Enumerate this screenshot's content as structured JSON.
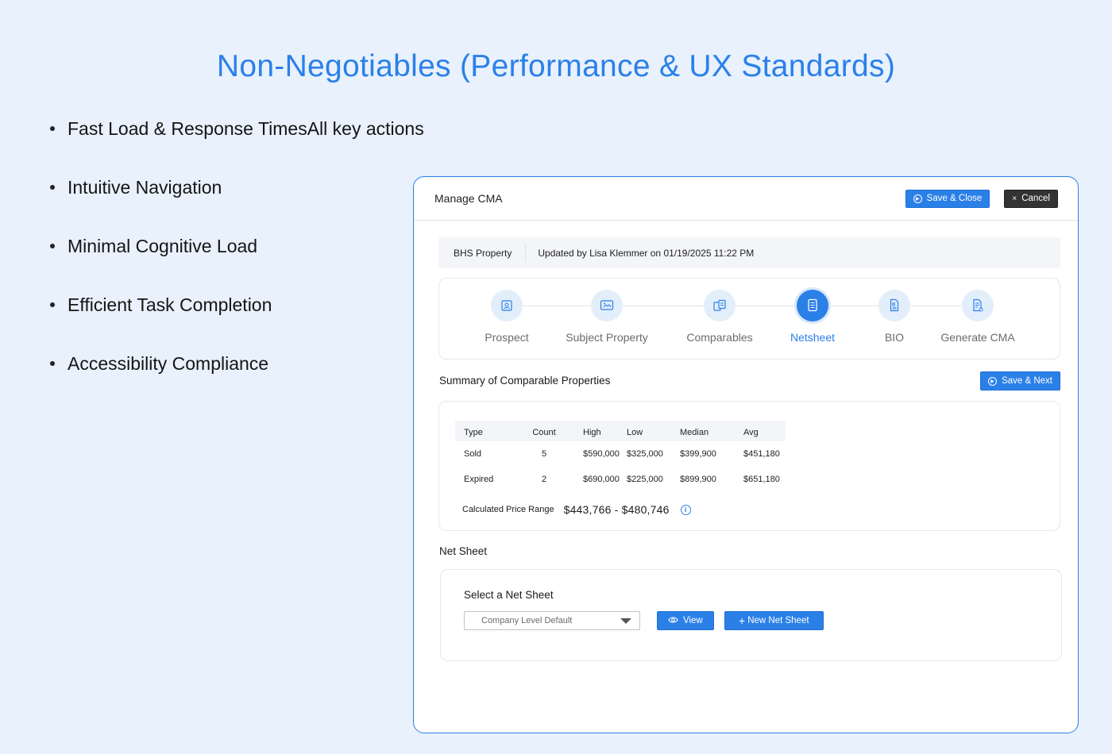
{
  "slide": {
    "title": "Non-Negotiables (Performance & UX Standards)",
    "bullets": [
      "Fast Load & Response TimesAll key actions",
      "Intuitive Navigation",
      "Minimal Cognitive Load",
      "Efficient Task Completion",
      "Accessibility Compliance"
    ]
  },
  "window": {
    "title": "Manage CMA",
    "save_close_label": "Save & Close",
    "cancel_label": "Cancel",
    "cancel_icon": "×"
  },
  "info_bar": {
    "property": "BHS Property",
    "updated": "Updated by Lisa Klemmer on 01/19/2025 11:22 PM"
  },
  "steps": [
    {
      "label": "Prospect",
      "icon": "id-card-icon",
      "active": false
    },
    {
      "label": "Subject Property",
      "icon": "property-image-icon",
      "active": false
    },
    {
      "label": "Comparables",
      "icon": "compare-docs-icon",
      "active": false
    },
    {
      "label": "Netsheet",
      "icon": "netsheet-doc-icon",
      "active": true
    },
    {
      "label": "BIO",
      "icon": "bio-doc-icon",
      "active": false
    },
    {
      "label": "Generate CMA",
      "icon": "generate-doc-icon",
      "active": false
    }
  ],
  "summary": {
    "title": "Summary of Comparable Properties",
    "save_next_label": "Save & Next",
    "columns": [
      "Type",
      "Count",
      "High",
      "Low",
      "Median",
      "Avg"
    ],
    "rows": [
      [
        "Sold",
        "5",
        "$590,000",
        "$325,000",
        "$399,900",
        "$451,180"
      ],
      [
        "Expired",
        "2",
        "$690,000",
        "$225,000",
        "$899,900",
        "$651,180"
      ]
    ],
    "price_range_label": "Calculated Price Range",
    "price_range_value": "$443,766 - $480,746"
  },
  "net_sheet": {
    "title": "Net Sheet",
    "select_label": "Select a Net Sheet",
    "select_value": "Company Level Default",
    "view_label": "View",
    "new_label": "New Net Sheet"
  },
  "colors": {
    "accent": "#2b80e8",
    "background": "#e8f1fc",
    "dark_button": "#333333"
  }
}
